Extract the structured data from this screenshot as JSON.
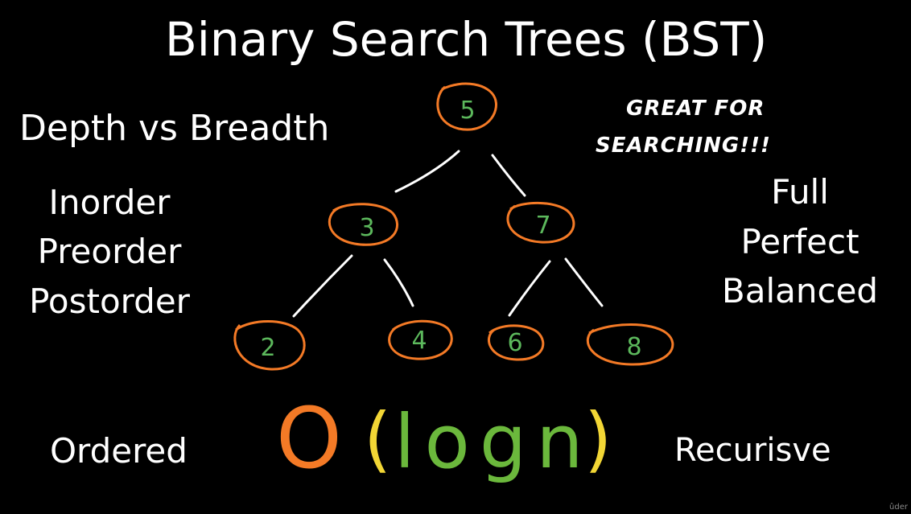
{
  "title": "Binary Search Trees (BST)",
  "left_topics": {
    "heading": "Depth vs Breadth",
    "traversals": [
      "Inorder",
      "Preorder",
      "Postorder"
    ]
  },
  "right_topics": {
    "note_line1": "GREAT FOR",
    "note_line2": "SEARCHING!!!",
    "types": [
      "Full",
      "Perfect",
      "Balanced"
    ]
  },
  "tree": {
    "nodes": [
      "5",
      "3",
      "7",
      "2",
      "4",
      "6",
      "8"
    ],
    "edges": [
      [
        "5",
        "3"
      ],
      [
        "5",
        "7"
      ],
      [
        "3",
        "2"
      ],
      [
        "3",
        "4"
      ],
      [
        "7",
        "6"
      ],
      [
        "7",
        "8"
      ]
    ]
  },
  "complexity": {
    "o": "O",
    "open_paren": "(",
    "expression": "logn",
    "close_paren": ")"
  },
  "bottom_left": "Ordered",
  "bottom_right": "Recurisve",
  "watermark": "ûder",
  "colors": {
    "background": "#000000",
    "text": "#ffffff",
    "node_circle": "#f47a26",
    "node_digit": "#5cb85c",
    "o_orange": "#f47a26",
    "paren_yellow": "#f2d635",
    "logn_green": "#6bb83c"
  }
}
